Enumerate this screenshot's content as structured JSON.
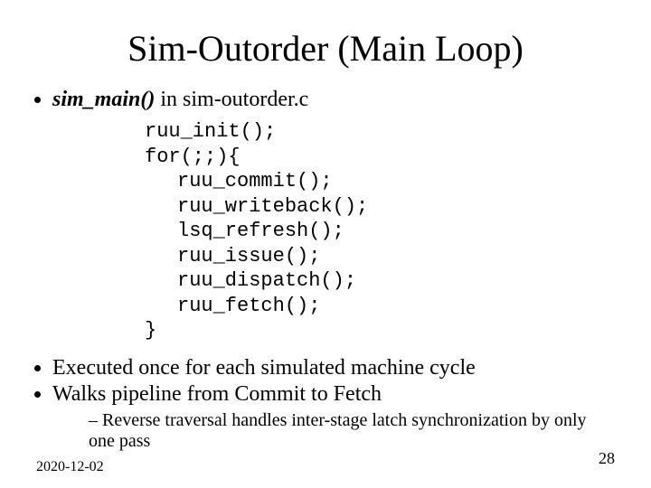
{
  "title": "Sim-Outorder (Main Loop)",
  "bullet1_emph": "sim_main()",
  "bullet1_rest": " in sim-outorder.c",
  "code": {
    "l1": "ruu_init();",
    "l2": "for(;;){",
    "l3": "ruu_commit();",
    "l4": "ruu_writeback();",
    "l5": "lsq_refresh();",
    "l6": "ruu_issue();",
    "l7": "ruu_dispatch();",
    "l8": "ruu_fetch();",
    "l9": "}"
  },
  "bullet2": "Executed once for each simulated machine cycle",
  "bullet3": "Walks pipeline from Commit to Fetch",
  "sub1": "Reverse traversal handles inter-stage latch synchronization by only one pass",
  "footer_date": "2020-12-02",
  "footer_page": "28"
}
